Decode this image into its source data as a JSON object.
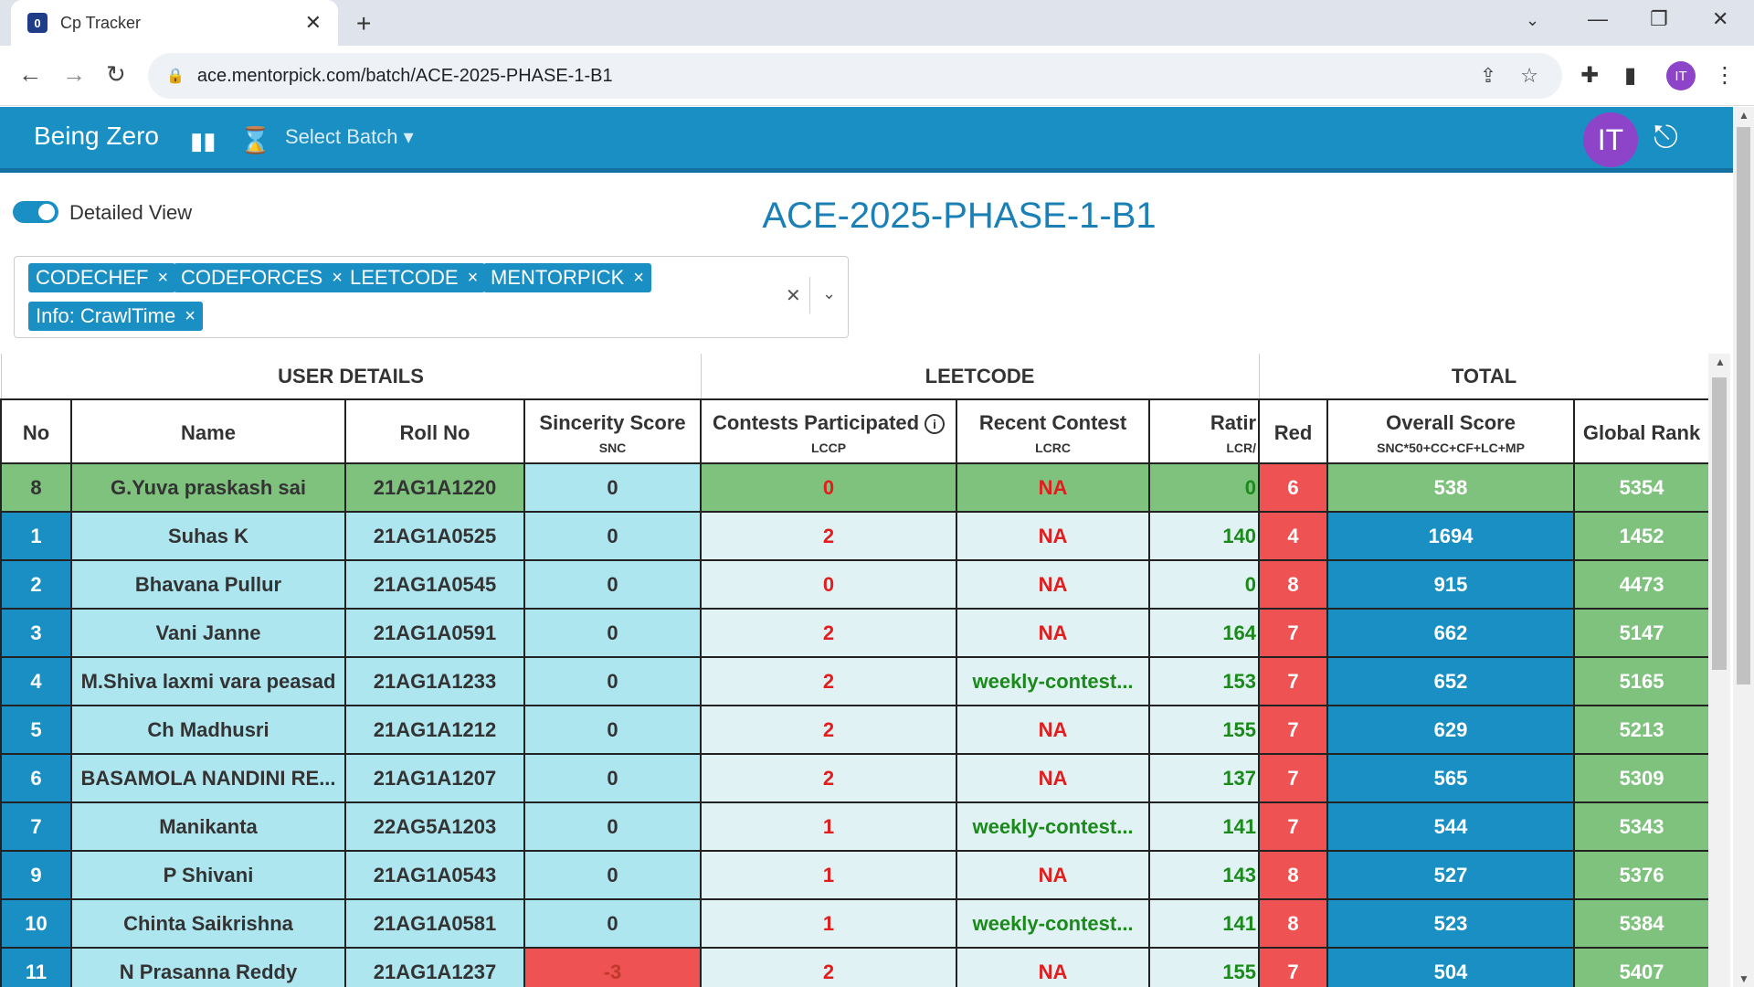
{
  "browser": {
    "tab_title": "Cp Tracker",
    "favicon_text": "0",
    "url": "ace.mentorpick.com/batch/ACE-2025-PHASE-1-B1",
    "profile_initials": "IT"
  },
  "navbar": {
    "brand": "Being Zero",
    "select_batch": "Select Batch",
    "avatar_initials": "IT"
  },
  "controls": {
    "toggle_label": "Detailed View",
    "toggle_on": true,
    "batch_title": "ACE-2025-PHASE-1-B1",
    "filter_chips": [
      "CODECHEF",
      "CODEFORCES",
      "LEETCODE",
      "MENTORPICK",
      "Info: CrawlTime"
    ]
  },
  "table": {
    "groups": [
      "USER DETAILS",
      "LEETCODE",
      "TOTAL"
    ],
    "columns": [
      {
        "label": "No",
        "sub": ""
      },
      {
        "label": "Name",
        "sub": ""
      },
      {
        "label": "Roll No",
        "sub": ""
      },
      {
        "label": "Sincerity Score",
        "sub": "SNC"
      },
      {
        "label": "Contests Participated",
        "sub": "LCCP"
      },
      {
        "label": "Recent Contest",
        "sub": "LCRC"
      },
      {
        "label": "Ratir",
        "sub": "LCR/"
      },
      {
        "label": "Red",
        "sub": ""
      },
      {
        "label": "Overall Score",
        "sub": "SNC*50+CC+CF+LC+MP"
      },
      {
        "label": "Global Rank",
        "sub": ""
      }
    ],
    "rows": [
      {
        "no": "8",
        "name": "G.Yuva praskash sai",
        "roll": "21AG1A1220",
        "snc": "0",
        "lccp": "0",
        "lcrc": "NA",
        "lcr": "0",
        "red": "6",
        "overall": "538",
        "rank": "5354"
      },
      {
        "no": "1",
        "name": "Suhas K",
        "roll": "21AG1A0525",
        "snc": "0",
        "lccp": "2",
        "lcrc": "NA",
        "lcr": "140",
        "red": "4",
        "overall": "1694",
        "rank": "1452"
      },
      {
        "no": "2",
        "name": "Bhavana Pullur",
        "roll": "21AG1A0545",
        "snc": "0",
        "lccp": "0",
        "lcrc": "NA",
        "lcr": "0",
        "red": "8",
        "overall": "915",
        "rank": "4473"
      },
      {
        "no": "3",
        "name": "Vani Janne",
        "roll": "21AG1A0591",
        "snc": "0",
        "lccp": "2",
        "lcrc": "NA",
        "lcr": "164",
        "red": "7",
        "overall": "662",
        "rank": "5147"
      },
      {
        "no": "4",
        "name": "M.Shiva laxmi vara peasad",
        "roll": "21AG1A1233",
        "snc": "0",
        "lccp": "2",
        "lcrc": "weekly-contest...",
        "lcr": "153",
        "red": "7",
        "overall": "652",
        "rank": "5165"
      },
      {
        "no": "5",
        "name": "Ch Madhusri",
        "roll": "21AG1A1212",
        "snc": "0",
        "lccp": "2",
        "lcrc": "NA",
        "lcr": "155",
        "red": "7",
        "overall": "629",
        "rank": "5213"
      },
      {
        "no": "6",
        "name": "BASAMOLA NANDINI RE...",
        "roll": "21AG1A1207",
        "snc": "0",
        "lccp": "2",
        "lcrc": "NA",
        "lcr": "137",
        "red": "7",
        "overall": "565",
        "rank": "5309"
      },
      {
        "no": "7",
        "name": "Manikanta",
        "roll": "22AG5A1203",
        "snc": "0",
        "lccp": "1",
        "lcrc": "weekly-contest...",
        "lcr": "141",
        "red": "7",
        "overall": "544",
        "rank": "5343"
      },
      {
        "no": "9",
        "name": "P Shivani",
        "roll": "21AG1A0543",
        "snc": "0",
        "lccp": "1",
        "lcrc": "NA",
        "lcr": "143",
        "red": "8",
        "overall": "527",
        "rank": "5376"
      },
      {
        "no": "10",
        "name": "Chinta Saikrishna",
        "roll": "21AG1A0581",
        "snc": "0",
        "lccp": "1",
        "lcrc": "weekly-contest...",
        "lcr": "141",
        "red": "8",
        "overall": "523",
        "rank": "5384"
      },
      {
        "no": "11",
        "name": "N Prasanna Reddy",
        "roll": "21AG1A1237",
        "snc": "-3",
        "lccp": "2",
        "lcrc": "NA",
        "lcr": "155",
        "red": "7",
        "overall": "504",
        "rank": "5407"
      }
    ]
  },
  "colors": {
    "primary": "#1a8fc4",
    "title": "#1a80b6",
    "avatar": "#8e44c9",
    "light_blue": "#aee6f0",
    "green": "#7ec27e",
    "red": "#ee5253",
    "text_red": "#e21d1d",
    "text_green": "#1a8a1a"
  }
}
